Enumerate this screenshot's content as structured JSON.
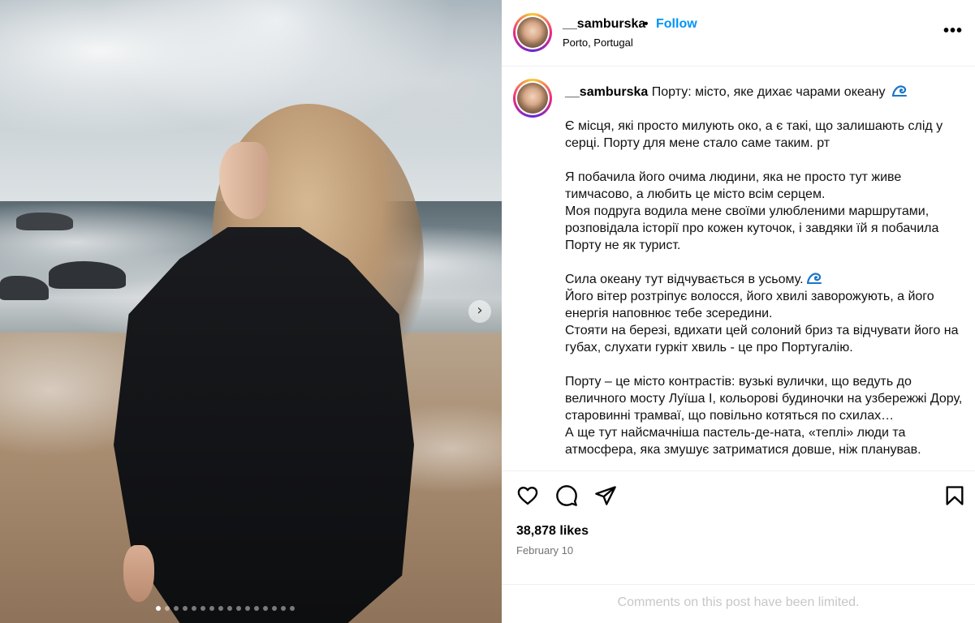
{
  "carousel": {
    "next_glyph": "›",
    "dot_count": 16,
    "active_index": 0
  },
  "header": {
    "username": "__samburska",
    "separator": "•",
    "follow_label": "Follow",
    "location": "Porto, Portugal",
    "more_glyph": "•••",
    "follow_color": "#0095f6"
  },
  "caption": {
    "username": "__samburska",
    "headline": "Порту: місто, яке дихає чарами океану",
    "paragraphs": [
      [
        "Є місця, які просто милують око, а є такі, що залишають слід у серці. Порту для мене стало саме таким. рт"
      ],
      [
        "Я побачила його очима людини, яка не просто тут живе тимчасово, а любить це місто всім серцем.",
        "Моя подруга водила мене своїми улюбленими маршрутами, розповідала історії про кожен куточок, і завдяки їй я побачила Порту не як турист."
      ],
      [
        "Сила океану тут відчувається в усьому.",
        "Його вітер розтріпує волосся, його хвилі заворожують, а його енергія наповнює тебе зсередини.",
        "Стояти на березі, вдихати цей солоний бриз та відчувати його на губах, слухати гуркіт хвиль - це про Португалію."
      ],
      [
        "Порту – це місто контрастів: вузькі вулички, що ведуть до величного мосту Луїша І, кольорові будиночки на узбережжі Дору, старовинні трамваї, що повільно котяться по схилах…",
        "А ще тут найсмачніша пастель-де-ната, «теплі» люди та атмосфера, яка змушує затриматися довше, ніж планував."
      ]
    ]
  },
  "icons": {
    "headline_emoji": "wave-emoji",
    "like": "heart-icon",
    "comment": "comment-icon",
    "share": "paper-plane-icon",
    "save": "bookmark-icon"
  },
  "stats": {
    "likes": "38,878 likes",
    "date": "February 10"
  },
  "comments": {
    "limited_text": "Comments on this post have been limited."
  }
}
